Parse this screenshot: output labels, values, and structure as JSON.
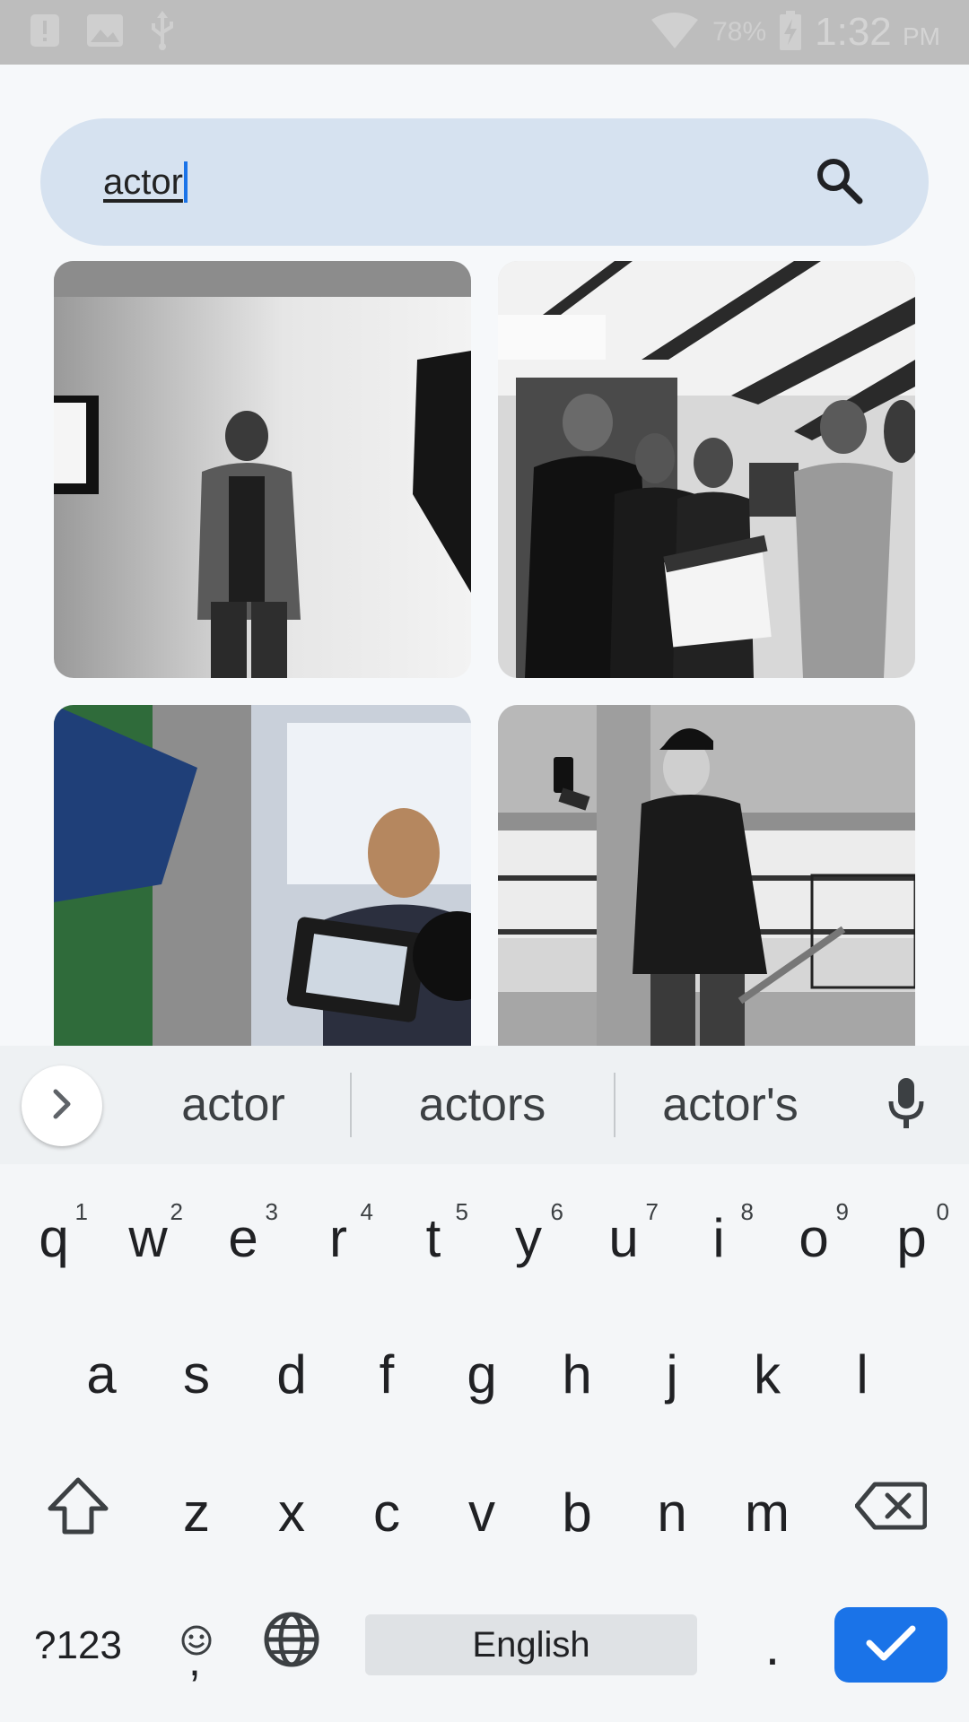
{
  "status_bar": {
    "battery_percent": "78%",
    "time": "1:32",
    "ampm": "PM",
    "icons": [
      "alert-icon",
      "image-icon",
      "usb-icon",
      "wifi-icon",
      "battery-charging-icon"
    ]
  },
  "search": {
    "query": "actor",
    "search_icon": "search-icon"
  },
  "results": [
    {
      "name": "image-result-1",
      "alt": "man in studio with lights"
    },
    {
      "name": "image-result-2",
      "alt": "group with clapperboard"
    },
    {
      "name": "image-result-3",
      "alt": "camera filming woman"
    },
    {
      "name": "image-result-4",
      "alt": "Chaplin impersonator"
    }
  ],
  "suggestions": [
    "actor",
    "actors",
    "actor's"
  ],
  "keyboard": {
    "row1": [
      {
        "k": "q",
        "h": "1"
      },
      {
        "k": "w",
        "h": "2"
      },
      {
        "k": "e",
        "h": "3"
      },
      {
        "k": "r",
        "h": "4"
      },
      {
        "k": "t",
        "h": "5"
      },
      {
        "k": "y",
        "h": "6"
      },
      {
        "k": "u",
        "h": "7"
      },
      {
        "k": "i",
        "h": "8"
      },
      {
        "k": "o",
        "h": "9"
      },
      {
        "k": "p",
        "h": "0"
      }
    ],
    "row2": [
      "a",
      "s",
      "d",
      "f",
      "g",
      "h",
      "j",
      "k",
      "l"
    ],
    "row3": [
      "z",
      "x",
      "c",
      "v",
      "b",
      "n",
      "m"
    ],
    "symbols_label": "?123",
    "comma_label": ",",
    "space_label": "English",
    "period_label": ".",
    "accent_color": "#1a73e8"
  }
}
